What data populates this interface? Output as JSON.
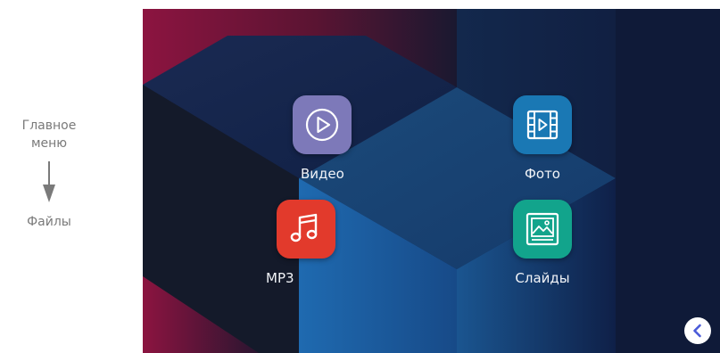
{
  "annotation": {
    "from": "Главное\nменю",
    "to": "Файлы"
  },
  "apps": {
    "video": {
      "label": "Видео",
      "icon": "play-circle-icon",
      "color": "#7d79b9"
    },
    "photo": {
      "label": "Фото",
      "icon": "film-strip-icon",
      "color": "#1a78b4"
    },
    "mp3": {
      "label": "MP3",
      "icon": "music-note-icon",
      "color": "#e23a2c"
    },
    "slides": {
      "label": "Слайды",
      "icon": "picture-frame-icon",
      "color": "#12a48c"
    }
  },
  "colors": {
    "background": "#0f1a36",
    "accent_magenta": "#8e1540",
    "accent_blue": "#1d6fb0",
    "back_button_icon": "#4a5ad8"
  }
}
